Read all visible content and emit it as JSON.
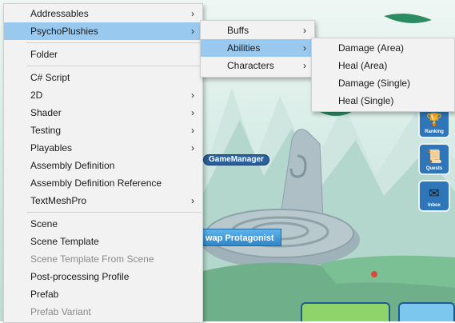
{
  "main_menu": {
    "items": [
      {
        "label": "Addressables",
        "submenu": true,
        "highlighted": false,
        "disabled": false
      },
      {
        "label": "PsychoPlushies",
        "submenu": true,
        "highlighted": true,
        "disabled": false
      },
      {
        "label": "Folder",
        "submenu": false,
        "highlighted": false,
        "disabled": false
      },
      {
        "label": "C# Script",
        "submenu": false,
        "highlighted": false,
        "disabled": false
      },
      {
        "label": "2D",
        "submenu": true,
        "highlighted": false,
        "disabled": false
      },
      {
        "label": "Shader",
        "submenu": true,
        "highlighted": false,
        "disabled": false
      },
      {
        "label": "Testing",
        "submenu": true,
        "highlighted": false,
        "disabled": false
      },
      {
        "label": "Playables",
        "submenu": true,
        "highlighted": false,
        "disabled": false
      },
      {
        "label": "Assembly Definition",
        "submenu": false,
        "highlighted": false,
        "disabled": false
      },
      {
        "label": "Assembly Definition Reference",
        "submenu": false,
        "highlighted": false,
        "disabled": false
      },
      {
        "label": "TextMeshPro",
        "submenu": true,
        "highlighted": false,
        "disabled": false
      },
      {
        "label": "Scene",
        "submenu": false,
        "highlighted": false,
        "disabled": false
      },
      {
        "label": "Scene Template",
        "submenu": false,
        "highlighted": false,
        "disabled": false
      },
      {
        "label": "Scene Template From Scene",
        "submenu": false,
        "highlighted": false,
        "disabled": true
      },
      {
        "label": "Post-processing Profile",
        "submenu": false,
        "highlighted": false,
        "disabled": false
      },
      {
        "label": "Prefab",
        "submenu": false,
        "highlighted": false,
        "disabled": false
      },
      {
        "label": "Prefab Variant",
        "submenu": false,
        "highlighted": false,
        "disabled": true
      }
    ]
  },
  "psychoplushies_menu": {
    "items": [
      {
        "label": "Buffs",
        "submenu": true,
        "highlighted": false
      },
      {
        "label": "Abilities",
        "submenu": true,
        "highlighted": true
      },
      {
        "label": "Characters",
        "submenu": true,
        "highlighted": false
      }
    ]
  },
  "abilities_menu": {
    "items": [
      {
        "label": "Damage (Area)"
      },
      {
        "label": "Heal (Area)"
      },
      {
        "label": "Damage (Single)"
      },
      {
        "label": "Heal (Single)"
      }
    ]
  },
  "scene": {
    "game_manager_tag": "GameManager",
    "swap_button_label": "wap Protagonist",
    "side_buttons": [
      {
        "label": "Ranking",
        "icon": "trophy-icon",
        "glyph": "🏆"
      },
      {
        "label": "Quests",
        "icon": "scroll-icon",
        "glyph": "📜"
      },
      {
        "label": "Inbox",
        "icon": "mail-icon",
        "glyph": "✉"
      }
    ]
  },
  "icons": {
    "submenu_arrow": "›"
  },
  "colors": {
    "highlight": "#99c9ef",
    "menu_bg": "#f2f2f2",
    "disabled_text": "#8a8a8a",
    "button_blue": "#2f76b8"
  }
}
